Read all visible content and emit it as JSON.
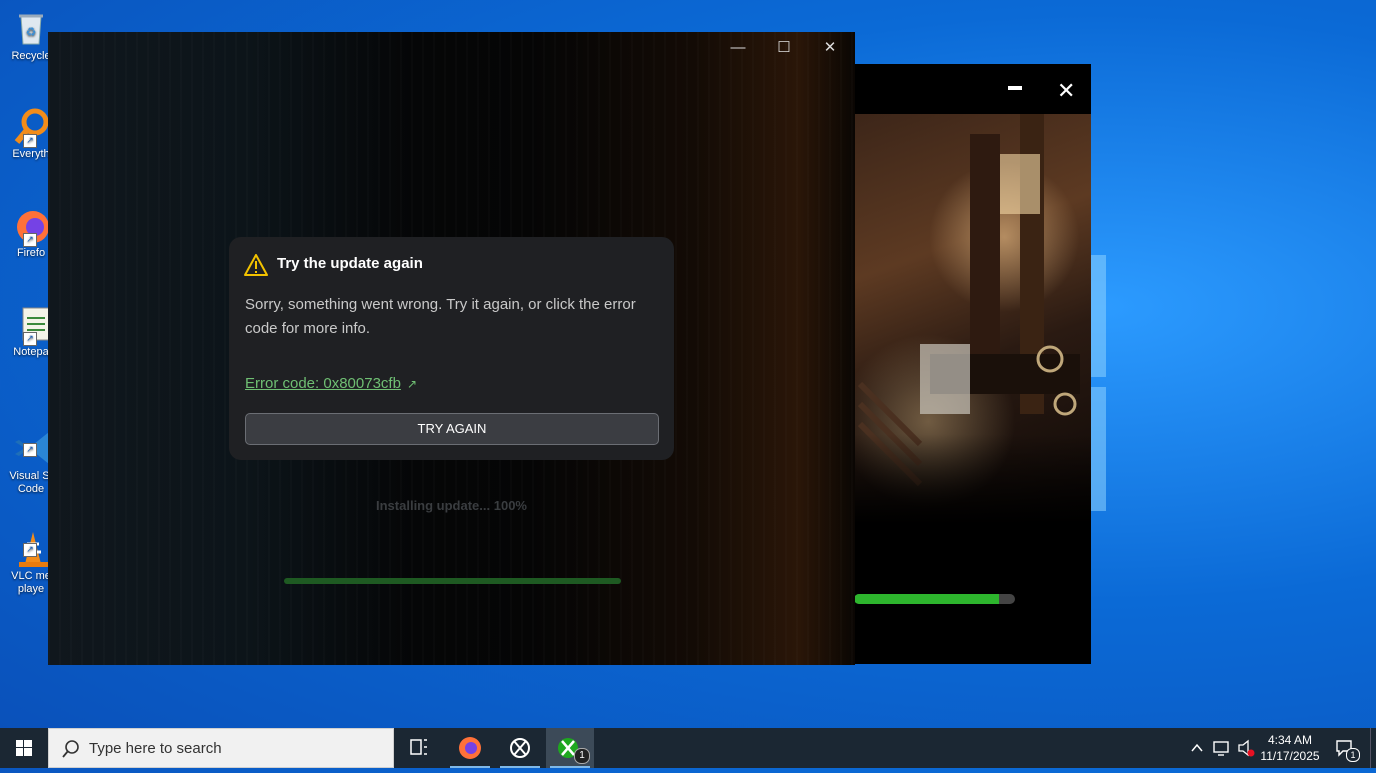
{
  "desktop": {
    "icons": [
      {
        "label": "Recycle",
        "icon": "recycle-bin-icon"
      },
      {
        "label": "Everyth",
        "icon": "magnifier-icon"
      },
      {
        "label": "Firefo",
        "icon": "firefox-icon"
      },
      {
        "label": "Notepa",
        "icon": "notepad-icon"
      },
      {
        "label": "Visual St\nCode",
        "icon": "vscode-icon"
      },
      {
        "label": "VLC me\nplaye",
        "icon": "vlc-icon"
      }
    ]
  },
  "front_window": {
    "controls": {
      "minimize": "—",
      "maximize": "☐",
      "close": "✕"
    },
    "dialog": {
      "title": "Try the update again",
      "message": "Sorry, something went wrong. Try it again, or click the error code for more info.",
      "error_link": "Error code: 0x80073cfb",
      "button": "TRY AGAIN"
    },
    "status": "Installing update... 100%",
    "progress": 1.0
  },
  "back_window": {
    "controls": {
      "minimize": "—",
      "close": "✕"
    },
    "progress": 0.9
  },
  "taskbar": {
    "search_placeholder": "Type here to search",
    "apps": [
      "task-view-icon",
      "firefox-icon",
      "xbox-icon",
      "xbox-app-icon"
    ],
    "xbox_badge": "1",
    "time": "4:34 AM",
    "date": "11/17/2025",
    "notification_badge": "1"
  }
}
